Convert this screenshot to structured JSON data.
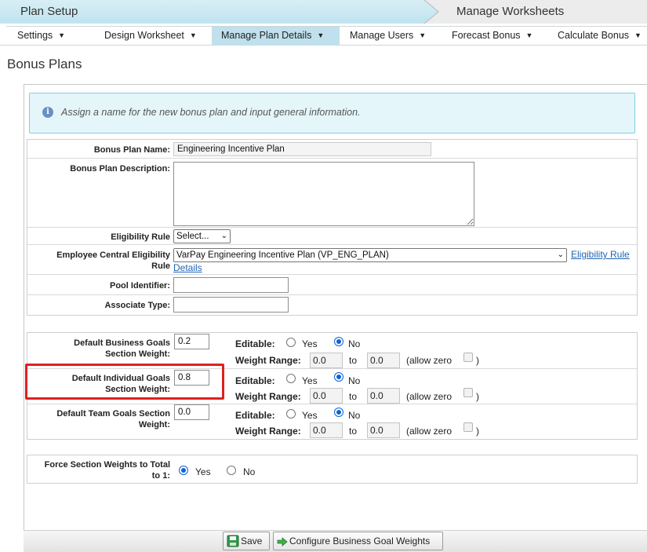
{
  "wizard": {
    "step1": "Plan Setup",
    "step2": "Manage Worksheets"
  },
  "tabs": [
    {
      "label": "Settings"
    },
    {
      "label": "Design Worksheet"
    },
    {
      "label": "Manage Plan Details"
    },
    {
      "label": "Manage Users"
    },
    {
      "label": "Forecast Bonus"
    },
    {
      "label": "Calculate Bonus"
    }
  ],
  "page_title": "Bonus Plans",
  "info_message": "Assign a name for the new bonus plan and input general information.",
  "general": {
    "plan_name_label": "Bonus Plan Name:",
    "plan_name_value": "Engineering Incentive Plan",
    "description_label": "Bonus Plan Description:",
    "eligibility_label": "Eligibility Rule",
    "eligibility_value": "Select...",
    "ec_rule_label_1": "Employee Central Eligibility",
    "ec_rule_label_2": "Rule",
    "ec_rule_value": "VarPay Engineering Incentive Plan (VP_ENG_PLAN)",
    "ec_rule_link_1": "Eligibility Rule",
    "ec_rule_link_2": "Details",
    "pool_label": "Pool Identifier:",
    "associate_label": "Associate Type:"
  },
  "weights_common": {
    "editable_label": "Editable:",
    "yes": "Yes",
    "no": "No",
    "range_label": "Weight Range:",
    "to": "to",
    "allow_zero_open": "(allow zero",
    "allow_zero_close": ")"
  },
  "weights": [
    {
      "label_1": "Default Business Goals",
      "label_2": "Section Weight:",
      "value": "0.2",
      "range_from": "0.0",
      "range_to": "0.0"
    },
    {
      "label_1": "Default Individual Goals",
      "label_2": "Section Weight:",
      "value": "0.8",
      "range_from": "0.0",
      "range_to": "0.0"
    },
    {
      "label_1": "Default Team Goals Section",
      "label_2": "Weight:",
      "value": "0.0",
      "range_from": "0.0",
      "range_to": "0.0"
    }
  ],
  "force": {
    "label_1": "Force Section Weights to Total",
    "label_2": "to 1:",
    "yes": "Yes",
    "no": "No"
  },
  "buttons": {
    "save": "Save",
    "configure": "Configure Business Goal Weights"
  },
  "colors": {
    "highlight": "#e02020",
    "active_tab": "#bfe0ec",
    "link": "#1f66b5",
    "radio": "#0b63d6"
  }
}
